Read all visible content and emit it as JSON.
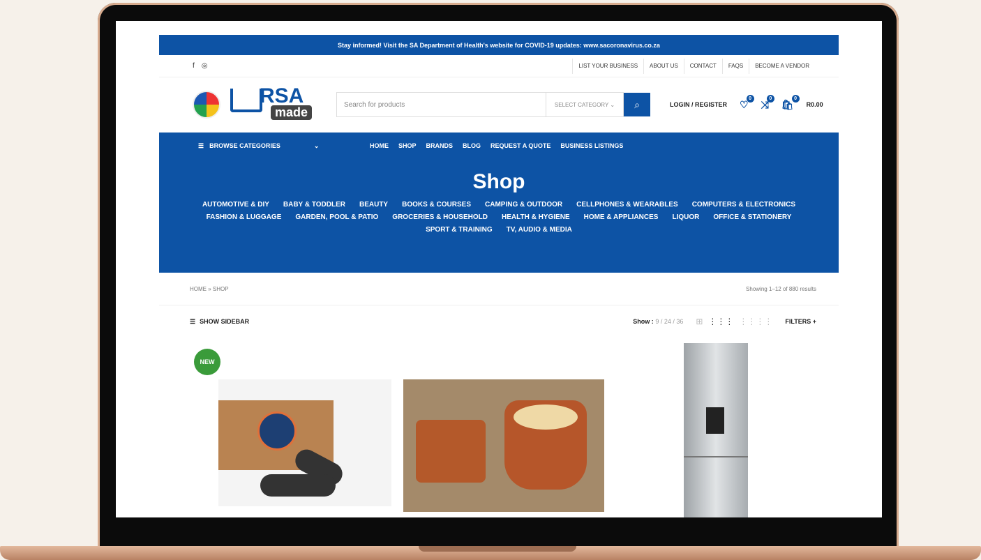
{
  "announcement": "Stay informed! Visit the SA Department of Health's website for COVID-19 updates: www.sacoronavirus.co.za",
  "social_icons": [
    "f",
    "◎"
  ],
  "util_links": [
    "LIST YOUR BUSINESS",
    "ABOUT US",
    "CONTACT",
    "FAQS",
    "BECOME A VENDOR"
  ],
  "logo": {
    "rsa": "RSA",
    "made": "made"
  },
  "search": {
    "placeholder": "Search for products",
    "category": "SELECT CATEGORY ⌄",
    "button_icon": "⌕"
  },
  "header": {
    "login": "LOGIN / REGISTER",
    "wishlist_icon": "♡",
    "wishlist_count": "0",
    "compare_icon": "⤨",
    "compare_count": "0",
    "cart_icon": "🛍",
    "cart_count": "0",
    "cart_total": "R0.00"
  },
  "nav": {
    "browse_icon": "☰",
    "browse_label": "BROWSE CATEGORIES",
    "browse_chevron": "⌄",
    "links": [
      "HOME",
      "SHOP",
      "BRANDS",
      "BLOG",
      "REQUEST A QUOTE",
      "BUSINESS LISTINGS"
    ]
  },
  "hero": {
    "title": "Shop",
    "categories": [
      "AUTOMOTIVE & DIY",
      "BABY & TODDLER",
      "BEAUTY",
      "BOOKS & COURSES",
      "CAMPING & OUTDOOR",
      "CELLPHONES & WEARABLES",
      "COMPUTERS & ELECTRONICS",
      "FASHION & LUGGAGE",
      "GARDEN, POOL & PATIO",
      "GROCERIES & HOUSEHOLD",
      "HEALTH & HYGIENE",
      "HOME & APPLIANCES",
      "LIQUOR",
      "OFFICE & STATIONERY",
      "SPORT & TRAINING",
      "TV, AUDIO & MEDIA"
    ]
  },
  "breadcrumb": "HOME » SHOP",
  "results": "Showing 1–12 of 880 results",
  "toolbar": {
    "sidebar_icon": "☰",
    "sidebar_label": "SHOW SIDEBAR",
    "show_label": "Show :",
    "show_options": "9  /  24  /  36",
    "grid_icons": [
      "⊞",
      "⋮⋮⋮",
      "⋮⋮⋮⋮"
    ],
    "filters_label": "FILTERS  +"
  },
  "products": {
    "badge": "NEW"
  }
}
